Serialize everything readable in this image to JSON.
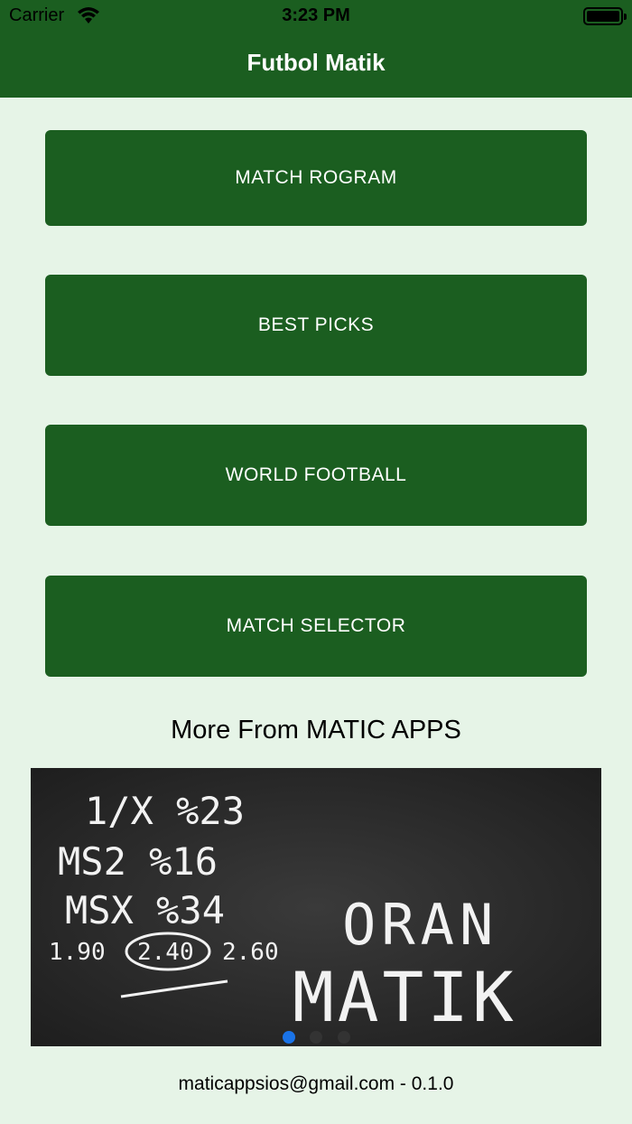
{
  "status_bar": {
    "carrier": "Carrier",
    "time": "3:23 PM"
  },
  "header": {
    "title": "Futbol Matik"
  },
  "menu": {
    "match_program": "MATCH ROGRAM",
    "best_picks": "BEST PICKS",
    "world_football": "WORLD FOOTBALL",
    "match_selector": "MATCH SELECTOR"
  },
  "promo": {
    "heading": "More From MATIC APPS",
    "banner_lines": [
      "1/X %23",
      "MS2 %16",
      "MSX %34",
      "1.90",
      "2.40",
      "2.60",
      "ORAN",
      "MATIK"
    ],
    "active_page": 1,
    "page_count": 3
  },
  "footer": {
    "text": "maticappsios@gmail.com - 0.1.0"
  },
  "colors": {
    "primary": "#1b5e20",
    "background": "#e6f4e7",
    "page_indicator_active": "#1a73e8"
  }
}
